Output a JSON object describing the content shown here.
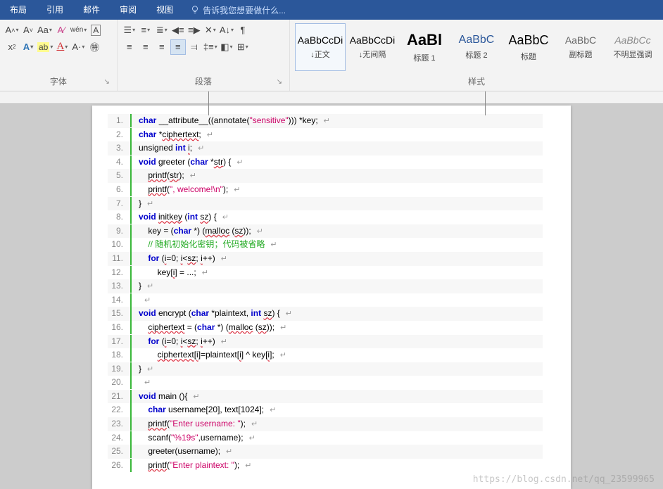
{
  "tabs": {
    "t1": "布局",
    "t2": "引用",
    "t3": "邮件",
    "t4": "审阅",
    "t5": "视图"
  },
  "hint": "告诉我您想要做什么...",
  "groups": {
    "font": "字体",
    "para": "段落",
    "styles": "样式"
  },
  "styles": {
    "s1p": "AaBbCcDi",
    "s1n": "↓正文",
    "s2p": "AaBbCcDi",
    "s2n": "↓无间隔",
    "s3p": "AaBl",
    "s3n": "标题 1",
    "s4p": "AaBbC",
    "s4n": "标题 2",
    "s5p": "AaBbC",
    "s5n": "标题",
    "s6p": "AaBbC",
    "s6n": "副标题",
    "s7p": "AaBbCc",
    "s7n": "不明显强调"
  },
  "code": {
    "l1a": "char",
    "l1b": " __attribute__((annotate(",
    "l1c": "\"sensitive\"",
    "l1d": "))) *key;",
    "l2a": "char",
    "l2b": " *",
    "l2c": "ciphertext",
    "l2d": ";",
    "l3a": "unsigned ",
    "l3b": "int",
    "l3c": " ",
    "l3d": "i",
    "l3e": ";",
    "l4a": "void",
    "l4b": " greeter (",
    "l4c": "char",
    "l4d": " *",
    "l4e": "str",
    "l4f": ") {",
    "l5a": "    ",
    "l5b": "printf",
    "l5c": "(",
    "l5d": "str",
    "l5e": ");",
    "l6a": "    ",
    "l6b": "printf",
    "l6c": "(",
    "l6d": "\", welcome!\\n\"",
    "l6e": ");",
    "l7": "}",
    "l8a": "void",
    "l8b": " ",
    "l8c": "initkey",
    "l8d": " (",
    "l8e": "int",
    "l8f": " ",
    "l8g": "sz",
    "l8h": ") {",
    "l9a": "    key = (",
    "l9b": "char",
    "l9c": " *) (",
    "l9d": "malloc",
    "l9e": " (",
    "l9f": "sz",
    "l9g": "));",
    "l10": "    // 随机初始化密钥；代码被省略",
    "l11a": "    ",
    "l11b": "for",
    "l11c": " (",
    "l11d": "i",
    "l11e": "=0; ",
    "l11f": "i",
    "l11g": "<",
    "l11h": "sz",
    "l11i": "; ",
    "l11j": "i",
    "l11k": "++)",
    "l12a": "        key[",
    "l12b": "i",
    "l12c": "] = ...;",
    "l13": "}",
    "l14": "",
    "l15a": "void",
    "l15b": " encrypt (",
    "l15c": "char",
    "l15d": " *plaintext, ",
    "l15e": "int",
    "l15f": " ",
    "l15g": "sz",
    "l15h": ") {",
    "l16a": "    ",
    "l16b": "ciphertext",
    "l16c": " = (",
    "l16d": "char",
    "l16e": " *) (",
    "l16f": "malloc",
    "l16g": " (",
    "l16h": "sz",
    "l16i": "));",
    "l17a": "    ",
    "l17b": "for",
    "l17c": " (",
    "l17d": "i",
    "l17e": "=0; ",
    "l17f": "i",
    "l17g": "<",
    "l17h": "sz",
    "l17i": "; ",
    "l17j": "i",
    "l17k": "++)",
    "l18a": "        ",
    "l18b": "ciphertext",
    "l18c": "[",
    "l18d": "i",
    "l18e": "]=plaintext[",
    "l18f": "i",
    "l18g": "] ^ key[",
    "l18h": "i",
    "l18i": "];",
    "l19": "}",
    "l20": "",
    "l21a": "void",
    "l21b": " main (){",
    "l22a": "    ",
    "l22b": "char",
    "l22c": " username[20], text[1024];",
    "l23a": "    ",
    "l23b": "printf",
    "l23c": "(",
    "l23d": "\"Enter username: \"",
    "l23e": ");",
    "l24a": "    scanf(",
    "l24b": "\"%19s\"",
    "l24c": ",username);",
    "l25a": "    greeter(username);",
    "l26a": "    ",
    "l26b": "printf",
    "l26c": "(",
    "l26d": "\"Enter plaintext: \"",
    "l26e": ");"
  },
  "ln": {
    "n1": "1.",
    "n2": "2.",
    "n3": "3.",
    "n4": "4.",
    "n5": "5.",
    "n6": "6.",
    "n7": "7.",
    "n8": "8.",
    "n9": "9.",
    "n10": "10.",
    "n11": "11.",
    "n12": "12.",
    "n13": "13.",
    "n14": "14.",
    "n15": "15.",
    "n16": "16.",
    "n17": "17.",
    "n18": "18.",
    "n19": "19.",
    "n20": "20.",
    "n21": "21.",
    "n22": "22.",
    "n23": "23.",
    "n24": "24.",
    "n25": "25.",
    "n26": "26."
  },
  "watermark": "https://blog.csdn.net/qq_23599965"
}
